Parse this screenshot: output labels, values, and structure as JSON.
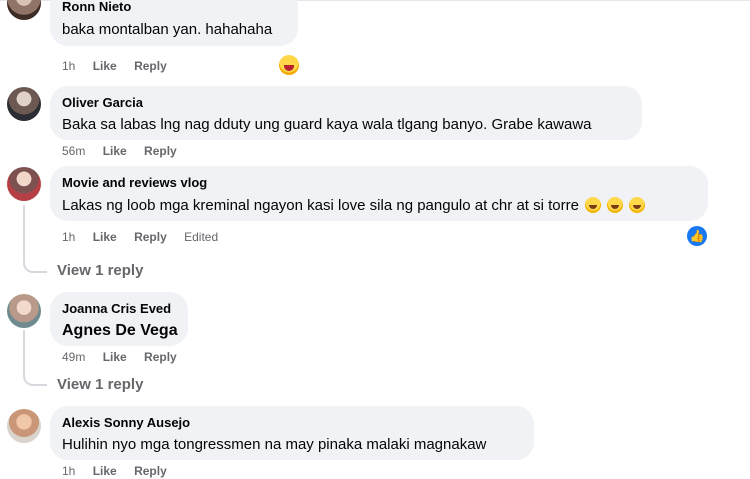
{
  "comments": [
    {
      "name": "Ronn Nieto",
      "text": "baka montalban yan. hahahaha",
      "time": "1h",
      "like": "Like",
      "reply": "Reply",
      "reaction": "haha-icon"
    },
    {
      "name": "Oliver Garcia",
      "text": "Baka sa labas lng nag dduty ung guard kaya wala tlgang banyo. Grabe kawawa",
      "time": "56m",
      "like": "Like",
      "reply": "Reply"
    },
    {
      "name": "Movie and reviews vlog",
      "text": "Lakas ng loob mga kreminal ngayon kasi love sila ng pangulo at chr at si torre",
      "time": "1h",
      "like": "Like",
      "reply": "Reply",
      "edited": "Edited",
      "reaction": "like-icon",
      "view_replies": "View 1 reply"
    },
    {
      "name": "Joanna Cris Eved",
      "text": "Agnes De Vega",
      "time": "49m",
      "like": "Like",
      "reply": "Reply",
      "view_replies": "View 1 reply"
    },
    {
      "name": "Alexis Sonny Ausejo",
      "text": "Hulihin nyo mga tongressmen na may pinaka malaki magnakaw",
      "time": "1h",
      "like": "Like",
      "reply": "Reply"
    }
  ]
}
